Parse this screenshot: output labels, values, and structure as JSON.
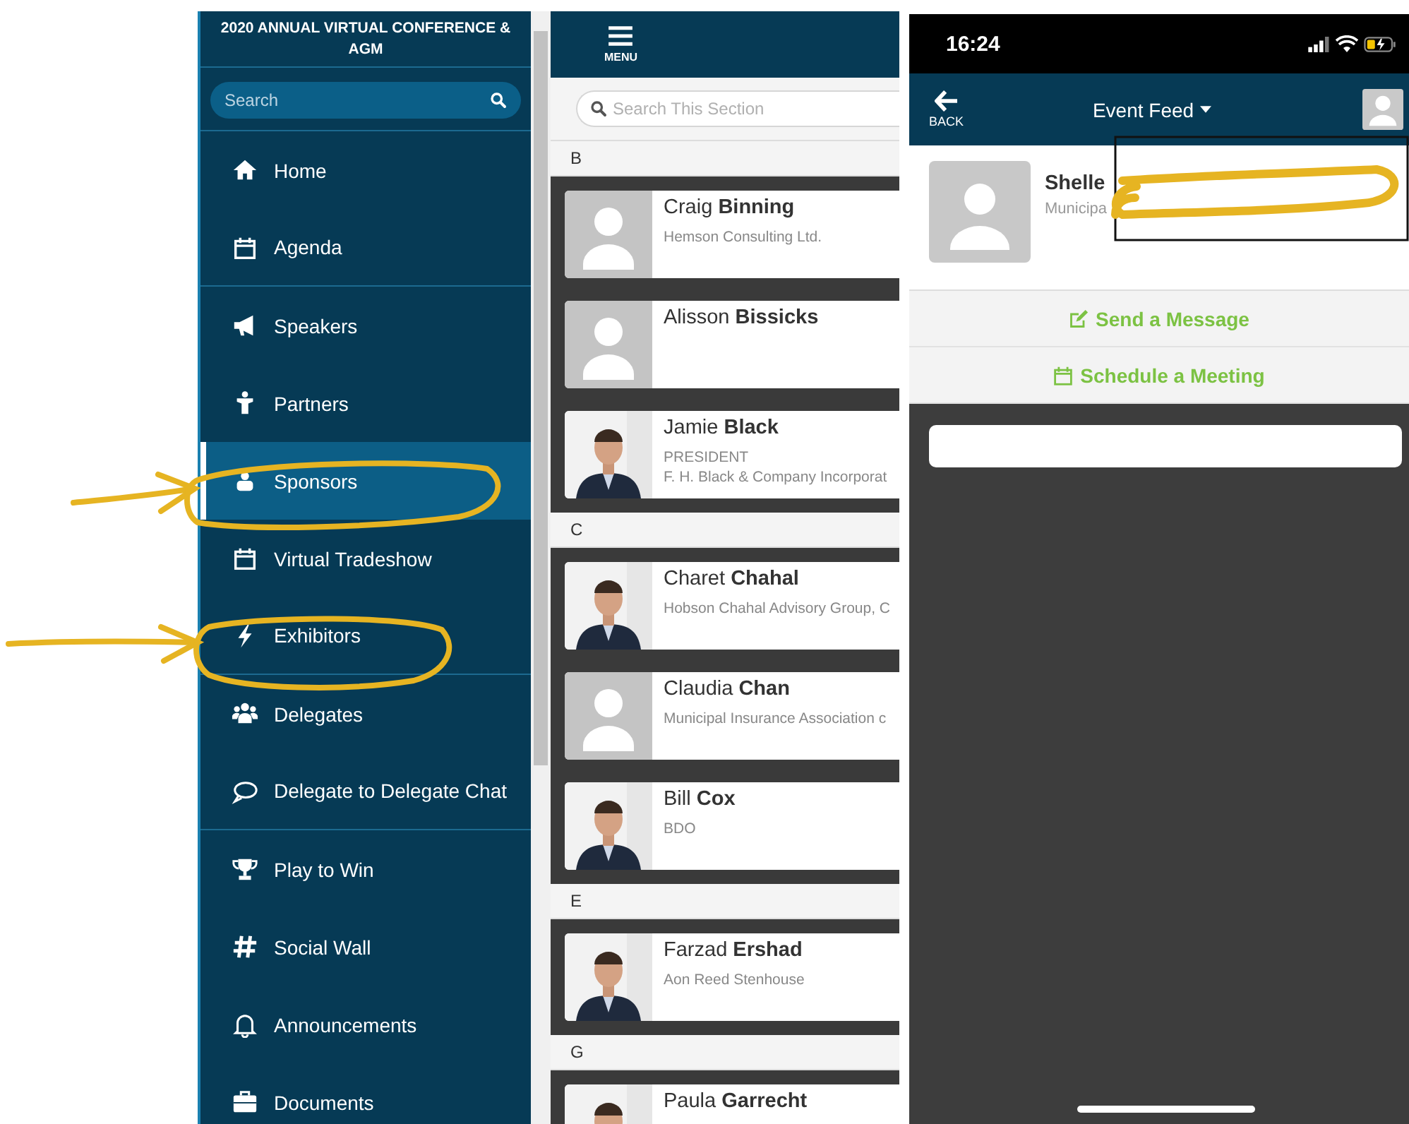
{
  "sidebar": {
    "title": "2020 ANNUAL VIRTUAL CONFERENCE & AGM",
    "search": {
      "placeholder": "Search"
    },
    "items": [
      {
        "label": "Home",
        "selected": false,
        "divider": false
      },
      {
        "label": "Agenda",
        "selected": false,
        "divider": true
      },
      {
        "label": "Speakers",
        "selected": false,
        "divider": false
      },
      {
        "label": "Partners",
        "selected": false,
        "divider": false
      },
      {
        "label": "Sponsors",
        "selected": true,
        "divider": false
      },
      {
        "label": "Virtual Tradeshow",
        "selected": false,
        "divider": false
      },
      {
        "label": "Exhibitors",
        "selected": false,
        "divider": true
      },
      {
        "label": "Delegates",
        "selected": false,
        "divider": false
      },
      {
        "label": "Delegate to Delegate Chat",
        "selected": false,
        "divider": true
      },
      {
        "label": "Play to Win",
        "selected": false,
        "divider": false
      },
      {
        "label": "Social Wall",
        "selected": false,
        "divider": false
      },
      {
        "label": "Announcements",
        "selected": false,
        "divider": false
      },
      {
        "label": "Documents",
        "selected": false,
        "divider": false
      }
    ]
  },
  "directory": {
    "menu_label": "MENU",
    "search": {
      "placeholder": "Search This Section"
    },
    "sections": [
      {
        "letter": "B",
        "people": [
          {
            "name": "Craig **Binning**",
            "lines": [
              "Hemson Consulting Ltd."
            ],
            "kind": "placeholder"
          },
          {
            "name": "Alisson **Bissicks**",
            "kind": "placeholder"
          },
          {
            "name": "Jamie **Black**",
            "lines": [
              "PRESIDENT",
              "F. H. Black & Company Incorporat"
            ],
            "kind": "picture"
          }
        ]
      },
      {
        "letter": "C",
        "people": [
          {
            "name": "Charet **Chahal**",
            "lines": [
              "Hobson Chahal Advisory Group, C"
            ],
            "kind": "picture"
          },
          {
            "name": "Claudia **Chan**",
            "lines": [
              "Municipal Insurance Association c"
            ],
            "kind": "placeholder"
          },
          {
            "name": "Bill **Cox**",
            "lines": [
              "BDO"
            ],
            "kind": "picture"
          }
        ]
      },
      {
        "letter": "E",
        "people": [
          {
            "name": "Farzad **Ershad**",
            "lines": [
              "Aon Reed Stenhouse"
            ],
            "kind": "picture"
          }
        ]
      },
      {
        "letter": "G",
        "people": [
          {
            "name": "Paula **Garrecht**",
            "kind": "picture"
          }
        ]
      }
    ]
  },
  "profile_screen": {
    "status_bar": {
      "time": "16:24"
    },
    "nav": {
      "back_label": "BACK",
      "title": "Event Feed"
    },
    "profile": {
      "name": "Shelle",
      "organization": "Municipa"
    },
    "actions": [
      {
        "label": "Send a Message",
        "kind": "message"
      },
      {
        "label": "Schedule a Meeting",
        "kind": "meeting"
      }
    ]
  }
}
